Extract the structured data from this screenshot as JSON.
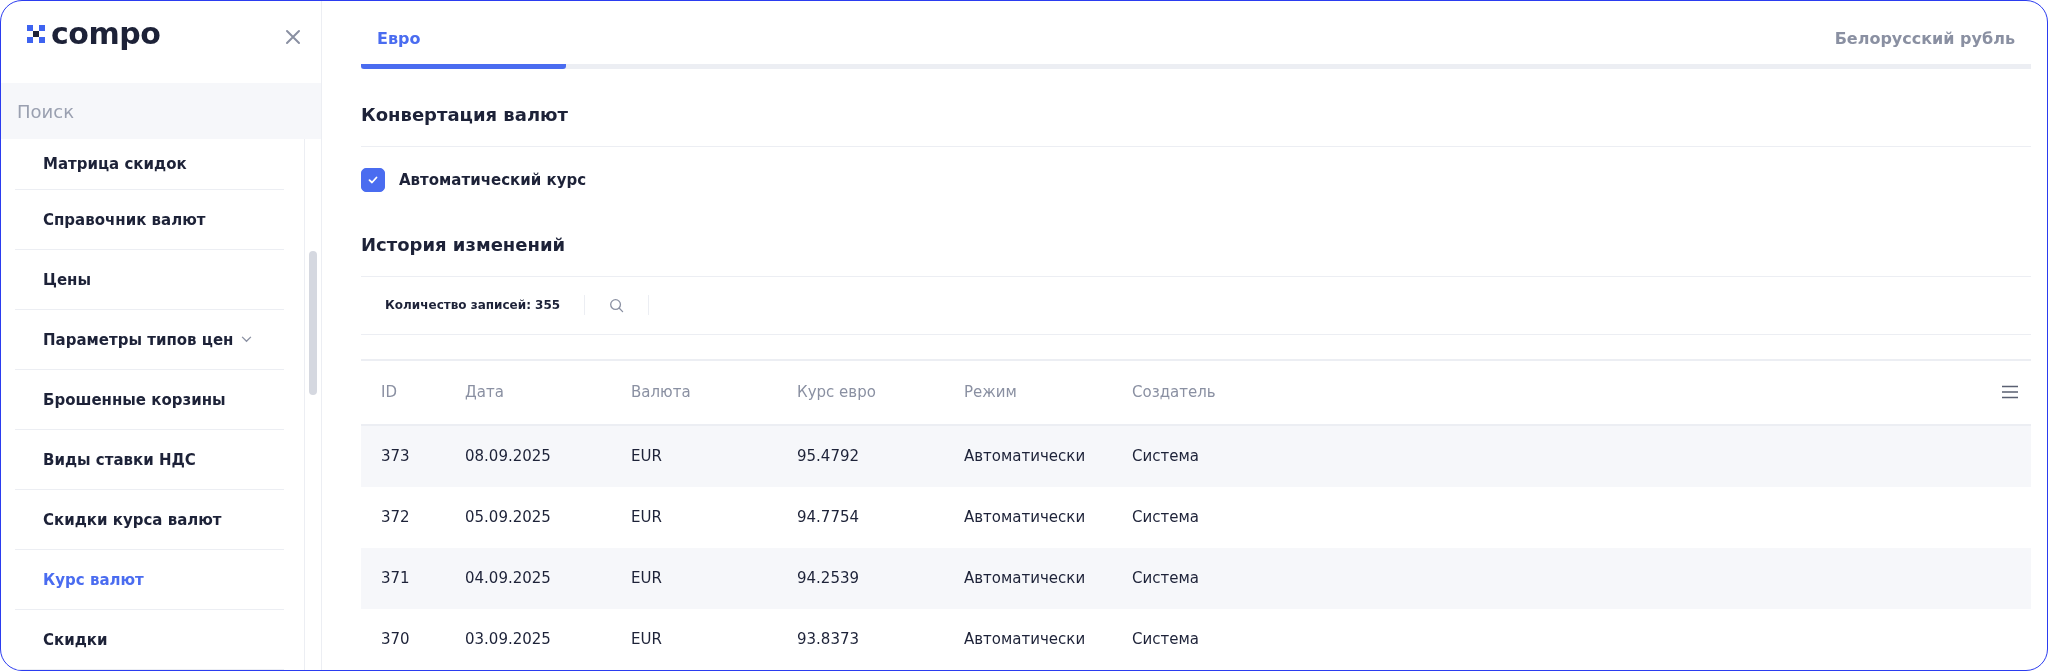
{
  "sidebar": {
    "logo": "compo",
    "search": {
      "placeholder": "Поиск"
    },
    "items": [
      {
        "label": "Матрица скидок",
        "selected": false,
        "expandable": false
      },
      {
        "label": "Справочник валют",
        "selected": false,
        "expandable": false
      },
      {
        "label": "Цены",
        "selected": false,
        "expandable": false
      },
      {
        "label": "Параметры типов цен",
        "selected": false,
        "expandable": true
      },
      {
        "label": "Брошенные корзины",
        "selected": false,
        "expandable": false
      },
      {
        "label": "Виды ставки НДС",
        "selected": false,
        "expandable": false
      },
      {
        "label": "Скидки курса валют",
        "selected": false,
        "expandable": false
      },
      {
        "label": "Курс валют",
        "selected": true,
        "expandable": false
      },
      {
        "label": "Скидки",
        "selected": false,
        "expandable": false
      }
    ]
  },
  "tabs": [
    {
      "label": "Евро",
      "selected": true
    },
    {
      "label": "Белорусский рубль",
      "selected": false
    }
  ],
  "conversion": {
    "title": "Конвертация валют",
    "checkbox": {
      "label": "Автоматический курс",
      "checked": true
    }
  },
  "history": {
    "title": "История изменений",
    "record_count": "Количество записей: 355",
    "table": {
      "columns": [
        "ID",
        "Дата",
        "Валюта",
        "Курс евро",
        "Режим",
        "Создатель"
      ],
      "rows": [
        [
          "373",
          "08.09.2025",
          "EUR",
          "95.4792",
          "Автоматически",
          "Система"
        ],
        [
          "372",
          "05.09.2025",
          "EUR",
          "94.7754",
          "Автоматически",
          "Система"
        ],
        [
          "371",
          "04.09.2025",
          "EUR",
          "94.2539",
          "Автоматически",
          "Система"
        ],
        [
          "370",
          "03.09.2025",
          "EUR",
          "93.8373",
          "Автоматически",
          "Система"
        ]
      ]
    }
  }
}
